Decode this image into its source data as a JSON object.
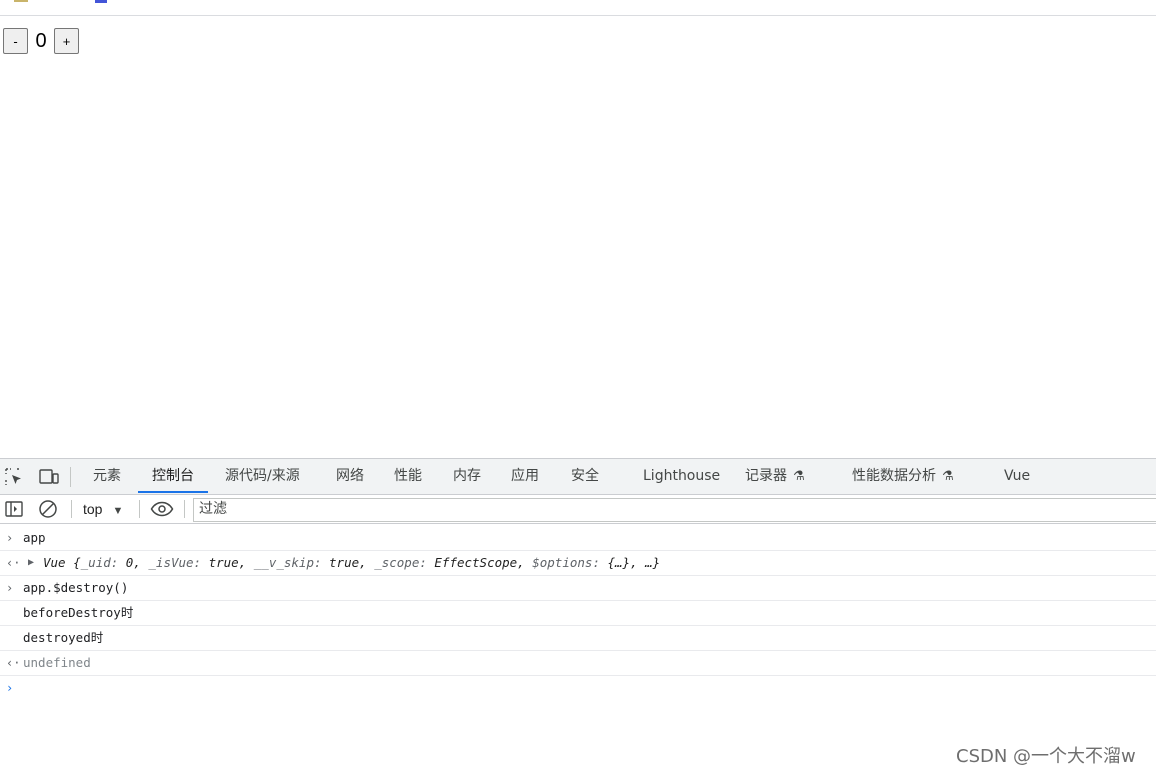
{
  "page": {
    "counter": {
      "minus_label": "-",
      "value": "0",
      "plus_label": "+"
    }
  },
  "devtools": {
    "icons": {
      "inspect": "inspect-element-icon",
      "device": "device-toolbar-icon"
    },
    "tabs": [
      {
        "label": "元素"
      },
      {
        "label": "控制台",
        "active": true
      },
      {
        "label": "源代码/来源"
      },
      {
        "label": "网络"
      },
      {
        "label": "性能"
      },
      {
        "label": "内存"
      },
      {
        "label": "应用"
      },
      {
        "label": "安全"
      },
      {
        "label": "Lighthouse"
      },
      {
        "label": "记录器",
        "icon": "flask-icon"
      },
      {
        "label": "性能数据分析",
        "icon": "flask-icon"
      },
      {
        "label": "Vue"
      }
    ],
    "toolbar": {
      "context": "top",
      "filter_placeholder": "过滤"
    },
    "console": {
      "lines": [
        {
          "type": "input",
          "text": "app"
        },
        {
          "type": "output-object",
          "text": "Vue {_uid: 0, _isVue: true, __v_skip: true, _scope: EffectScope, $options: {…}, …}"
        },
        {
          "type": "input",
          "text": "app.$destroy()"
        },
        {
          "type": "log",
          "text": "beforeDestroy时"
        },
        {
          "type": "log",
          "text": "destroyed时"
        },
        {
          "type": "output",
          "text": "undefined"
        }
      ]
    }
  },
  "watermark": "CSDN @一个大不溜w",
  "colors": {
    "accent": "#1a73e8",
    "tabbar_bg": "#f1f3f4",
    "value_keyword": "#1a1aa6"
  }
}
